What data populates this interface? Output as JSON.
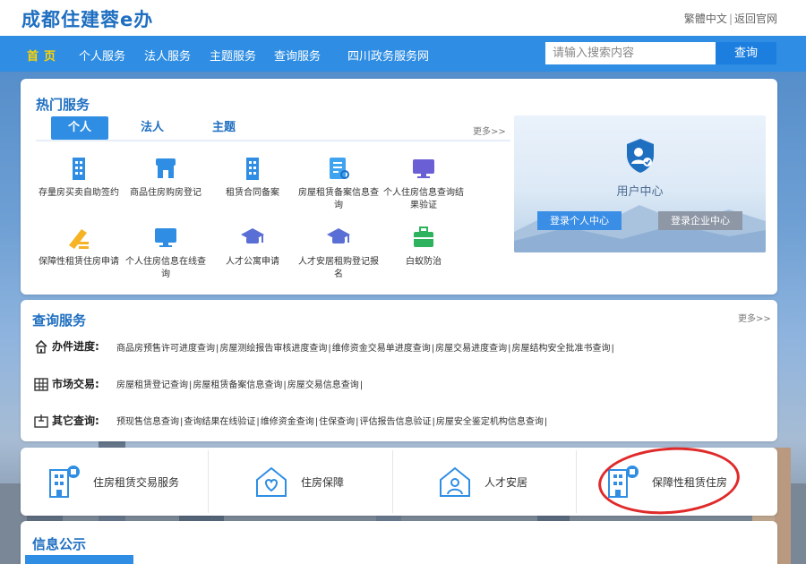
{
  "header": {
    "logo": "成都住建蓉e办",
    "links": [
      "繁體中文",
      "返回官网"
    ]
  },
  "nav": {
    "items": [
      "首页",
      "个人服务",
      "法人服务",
      "主题服务",
      "查询服务",
      "四川政务服务网"
    ],
    "search_placeholder": "请输入搜索内容",
    "search_button": "查询"
  },
  "hot_services": {
    "title": "热门服务",
    "tabs": [
      "个人",
      "法人",
      "主题"
    ],
    "active_tab": "个人",
    "more": "更多>>",
    "items": [
      {
        "label": "存量房买卖自助签约",
        "icon": "building-icon"
      },
      {
        "label": "商品住房购房登记",
        "icon": "shop-icon"
      },
      {
        "label": "租赁合同备案",
        "icon": "building-icon"
      },
      {
        "label": "房屋租赁备案信息查询",
        "icon": "document-search-icon"
      },
      {
        "label": "个人住房信息查询结果验证",
        "icon": "monitor-icon"
      },
      {
        "label": "保障性租赁住房申请",
        "icon": "pen-icon"
      },
      {
        "label": "个人住房信息在线查询",
        "icon": "monitor-icon"
      },
      {
        "label": "人才公寓申请",
        "icon": "graduation-cap-icon"
      },
      {
        "label": "人才安居租购登记报名",
        "icon": "graduation-cap-icon"
      },
      {
        "label": "白蚁防治",
        "icon": "briefcase-icon"
      }
    ]
  },
  "user_center": {
    "title": "用户中心",
    "personal_login": "登录个人中心",
    "enterprise_login": "登录企业中心",
    "colors": {
      "personal": "#3a8ee6",
      "enterprise": "#8d97a6"
    }
  },
  "query_services": {
    "title": "查询服务",
    "more": "更多>>",
    "rows": [
      {
        "label": "办件进度:",
        "icon": "house-icon",
        "links": [
          "商品房预售许可进度查询",
          "房屋测绘报告审核进度查询",
          "维修资金交易单进度查询",
          "房屋交易进度查询",
          "房屋结构安全批准书查询"
        ]
      },
      {
        "label": "市场交易:",
        "icon": "building-grid-icon",
        "links": [
          "房屋租赁登记查询",
          "房屋租赁备案信息查询",
          "房屋交易信息查询"
        ]
      },
      {
        "label": "其它查询:",
        "icon": "box-icon",
        "links": [
          "预现售信息查询",
          "查询结果在线验证",
          "维修资金查询",
          "住保查询",
          "评估报告信息验证",
          "房屋安全鉴定机构信息查询"
        ]
      }
    ]
  },
  "features": [
    {
      "label": "住房租赁交易服务",
      "icon": "rental-building-icon"
    },
    {
      "label": "住房保障",
      "icon": "house-heart-icon"
    },
    {
      "label": "人才安居",
      "icon": "house-person-icon"
    },
    {
      "label": "保障性租赁住房",
      "icon": "rental-building-icon"
    }
  ],
  "info": {
    "title": "信息公示"
  },
  "colors": {
    "brand": "#1f6fc1",
    "nav": "#2f8ee3",
    "nav_active": "#ffd400",
    "annotation": "#e02a2a"
  }
}
